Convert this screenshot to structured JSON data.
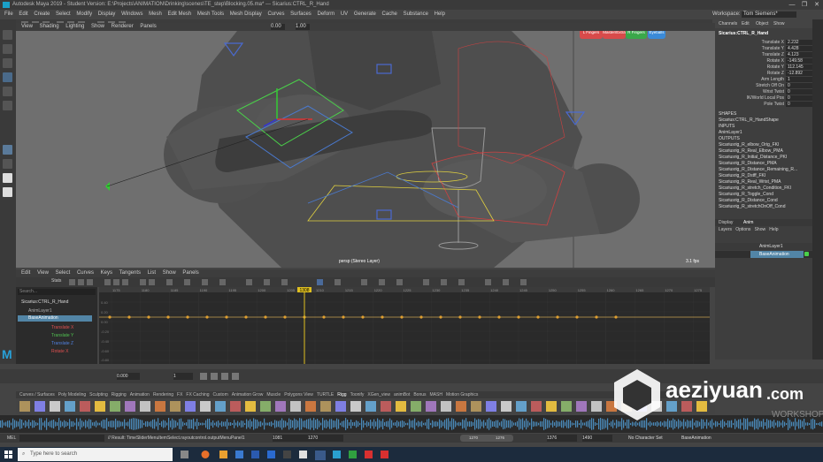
{
  "window": {
    "title": "Autodesk Maya 2019 - Student Version: E:\\Projects\\ANIMATION\\Drinking\\scenes\\TE_step\\Blocking.05.ma* --- Sicarius:CTRL_R_Hand",
    "controls": [
      "—",
      "❐",
      "✕"
    ]
  },
  "menubar": [
    "File",
    "Edit",
    "Create",
    "Select",
    "Modify",
    "Display",
    "Windows",
    "Mesh",
    "Edit Mesh",
    "Mesh Tools",
    "Mesh Display",
    "Curves",
    "Surfaces",
    "Deform",
    "UV",
    "Generate",
    "Cache",
    "Substance",
    "Help"
  ],
  "workspace": {
    "label": "Workspace:",
    "value": "Tom Siemens*"
  },
  "viewport": {
    "menu": [
      "View",
      "Shading",
      "Lighting",
      "Show",
      "Renderer",
      "Panels"
    ],
    "field_a": "0.00",
    "field_b": "1.00",
    "camera_label": "persp (Stereo Layer)",
    "fps": "3.1 fps",
    "picker_buttons": [
      {
        "label": "L Fingers",
        "color": "#d84a4a"
      },
      {
        "label": "Master/Extra",
        "color": "#d84a4a"
      },
      {
        "label": "R Fingers",
        "color": "#3aa84a"
      },
      {
        "label": "Eyeballs",
        "color": "#3a8ad8"
      }
    ]
  },
  "graph_editor": {
    "menu": [
      "Edit",
      "View",
      "Select",
      "Curves",
      "Keys",
      "Tangents",
      "List",
      "Show",
      "Panels"
    ],
    "search_placeholder": "Search...",
    "stats_label": "Stats",
    "outliner": [
      {
        "label": "Sicarius:CTRL_R_Hand",
        "type": "header"
      },
      {
        "label": "AnimLayer1",
        "type": "item"
      },
      {
        "label": "BaseAnimation",
        "type": "selected"
      },
      {
        "label": "Translate X",
        "type": "red"
      },
      {
        "label": "Translate Y",
        "type": "green"
      },
      {
        "label": "Translate Z",
        "type": "blue"
      },
      {
        "label": "Rotate X",
        "type": "red"
      }
    ],
    "frame_ticks": [
      "1175",
      "1180",
      "1185",
      "1190",
      "1195",
      "1200",
      "1205",
      "1210",
      "1215",
      "1220",
      "1225",
      "1230",
      "1235",
      "1240",
      "1245",
      "1250",
      "1255",
      "1260",
      "1265",
      "1270",
      "1275"
    ],
    "current_frame": "1308",
    "y_ticks": [
      "0.40",
      "0.20",
      "0.00",
      "-0.20",
      "-0.40",
      "-0.60",
      "-0.80"
    ]
  },
  "channel_box": {
    "tabs": [
      "Channels",
      "Edit",
      "Object",
      "Show"
    ],
    "node": "Sicarius:CTRL_R_Hand",
    "attributes": [
      {
        "label": "Translate X",
        "value": "2.232"
      },
      {
        "label": "Translate Y",
        "value": "4.428"
      },
      {
        "label": "Translate Z",
        "value": "4.123"
      },
      {
        "label": "Rotate X",
        "value": "-149.58"
      },
      {
        "label": "Rotate Y",
        "value": "112.145"
      },
      {
        "label": "Rotate Z",
        "value": "-12.892"
      },
      {
        "label": "Arm Length",
        "value": "1"
      },
      {
        "label": "Stretch Off On",
        "value": "0"
      },
      {
        "label": "Wrist Twist",
        "value": "0"
      },
      {
        "label": "IK/World Local Pos",
        "value": "0"
      },
      {
        "label": "Pole Twist",
        "value": "0"
      }
    ],
    "shapes_header": "SHAPES",
    "shape": "Sicarius:CTRL_R_HandShape",
    "inputs_header": "INPUTS",
    "input": "AnimLayer1",
    "outputs_header": "OUTPUTS",
    "outputs": [
      "Sicariusrig_R_elbow_Orig_FKI",
      "Sicariusrig_R_Real_Elbow_PMA",
      "Sicariusrig_R_Initial_Distance_PKI",
      "Sicariusrig_R_Distance_PMA",
      "Sicariusrig_R_Distance_Remaining_R...",
      "Sicariusrig_R_Dstff_FKI",
      "Sicariusrig_R_Real_Wrist_PMA",
      "Sicariusrig_R_stretch_Condition_FKI",
      "Sicariusrig_R_Toggle_Cond",
      "Sicariusrig_R_Distance_Cond",
      "Sicariusrig_R_stretchOnOff_Cond"
    ],
    "layer_tabs": [
      "Display",
      "Anim"
    ],
    "layer_menu": [
      "Layers",
      "Options",
      "Show",
      "Help"
    ],
    "layers": [
      {
        "label": "AnimLayer1",
        "selected": false
      },
      {
        "label": "BaseAnimation",
        "selected": true
      }
    ]
  },
  "range": {
    "start": "0.000",
    "current": "1",
    "end_a": "1081",
    "end_b": "1270",
    "range_start": "1270",
    "range_end": "1276",
    "anim_end": "1376",
    "frames": "1490",
    "char_set": "No Character Set",
    "anim_layer": "BaseAnimation"
  },
  "shelf_tabs": [
    "Curves / Surfaces",
    "Poly Modeling",
    "Sculpting",
    "Rigging",
    "Animation",
    "Rendering",
    "FX",
    "FX Caching",
    "Custom",
    "Animation Grow",
    "Muscle",
    "Polygons View",
    "TURTLE",
    "Rigg",
    "Toonify",
    "XGen_view",
    "animBot",
    "Bonus",
    "MASH",
    "Motion Graphics"
  ],
  "cmdline": {
    "label": "MEL",
    "result": "// Result: TimeSliderMenuItemSelect.rayoutcontrol.outputMenuPanel1"
  },
  "taskbar": {
    "search_placeholder": "Type here to search"
  },
  "watermark": {
    "site": "aeziyuan",
    "tld": ".com",
    "sub": "WORKSHOP"
  }
}
